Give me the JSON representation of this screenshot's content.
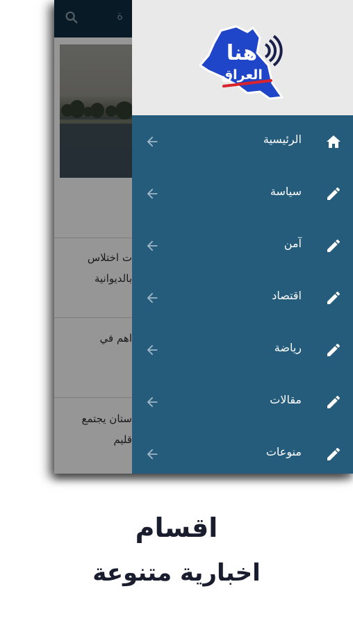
{
  "toolbar": {
    "title_fragment": "ة"
  },
  "feed": {
    "items": [
      {
        "line1": "ت اختلاس",
        "line2": "بالديوانية"
      },
      {
        "line1": "اهم في",
        "line2": ""
      },
      {
        "line1": "ستان يجتمع",
        "line2": "قليم"
      }
    ]
  },
  "drawer": {
    "logo_text_top": "هنا",
    "logo_text_bottom": "العراق",
    "items": [
      {
        "label": "الرئيسية",
        "icon": "home-icon"
      },
      {
        "label": "سياسة",
        "icon": "pencil-icon"
      },
      {
        "label": "آمن",
        "icon": "pencil-icon"
      },
      {
        "label": "اقتصاد",
        "icon": "pencil-icon"
      },
      {
        "label": "رياضة",
        "icon": "pencil-icon"
      },
      {
        "label": "مقالات",
        "icon": "pencil-icon"
      },
      {
        "label": "منوعات",
        "icon": "pencil-icon"
      }
    ]
  },
  "caption": {
    "line1": "اقسام",
    "line2": "اخبارية    متنوعة"
  },
  "colors": {
    "drawer_bg": "#255c7c",
    "header_bg": "#e9e9e9",
    "toolbar_bg": "#0e2b3e",
    "logo_blue": "#1f45c8",
    "caption_text": "#1a1d2e"
  }
}
